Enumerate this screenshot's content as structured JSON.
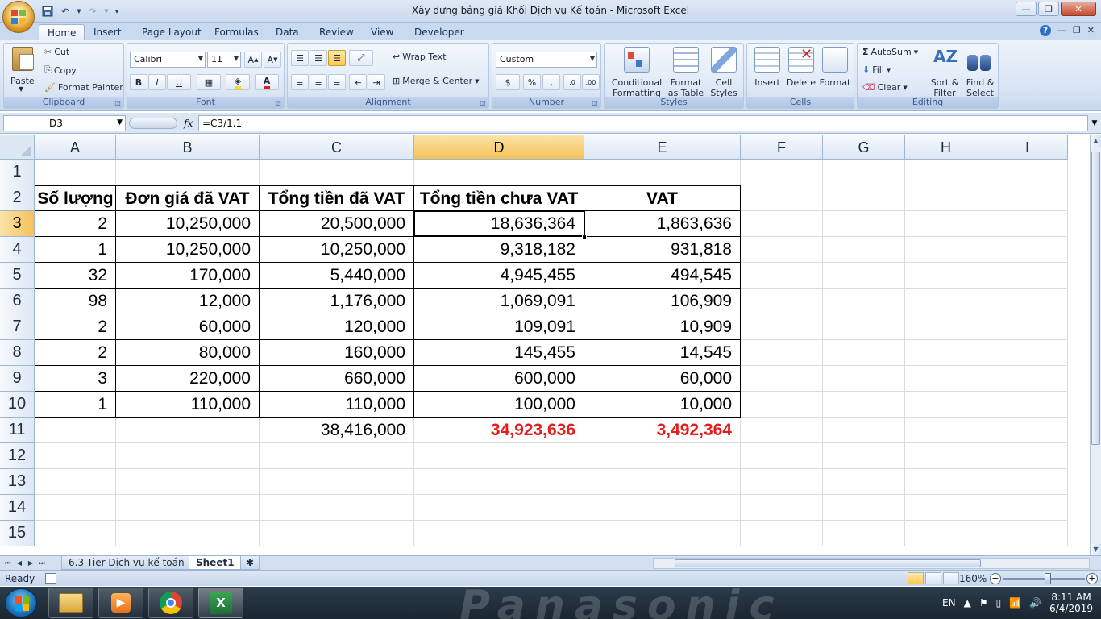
{
  "window": {
    "title": "Xây dựng bảng giá Khối Dịch vụ Kế toán - Microsoft Excel"
  },
  "ribbon_tabs": [
    "Home",
    "Insert",
    "Page Layout",
    "Formulas",
    "Data",
    "Review",
    "View",
    "Developer"
  ],
  "active_tab": "Home",
  "ribbon": {
    "clipboard": {
      "label": "Clipboard",
      "paste": "Paste",
      "cut": "Cut",
      "copy": "Copy",
      "format_painter": "Format Painter"
    },
    "font": {
      "label": "Font",
      "font_name": "Calibri",
      "font_size": "11",
      "bold": "B",
      "italic": "I",
      "underline": "U"
    },
    "alignment": {
      "label": "Alignment",
      "wrap_text": "Wrap Text",
      "merge_center": "Merge & Center"
    },
    "number": {
      "label": "Number",
      "format": "Custom",
      "currency": "$",
      "percent": "%",
      "comma": ","
    },
    "styles": {
      "label": "Styles",
      "conditional": "Conditional",
      "conditional2": "Formatting",
      "format_as": "Format",
      "format_as2": "as Table",
      "cell": "Cell",
      "cell2": "Styles"
    },
    "cells": {
      "label": "Cells",
      "insert": "Insert",
      "delete": "Delete",
      "format": "Format"
    },
    "editing": {
      "label": "Editing",
      "autosum": "AutoSum",
      "fill": "Fill",
      "clear": "Clear",
      "sort": "Sort &",
      "sort2": "Filter",
      "find": "Find &",
      "find2": "Select"
    }
  },
  "formula_bar": {
    "name_box": "D3",
    "fx": "fx",
    "formula": "=C3/1.1"
  },
  "columns": [
    "A",
    "B",
    "C",
    "D",
    "E",
    "F",
    "G",
    "H",
    "I"
  ],
  "rows": [
    "1",
    "2",
    "3",
    "4",
    "5",
    "6",
    "7",
    "8",
    "9",
    "10",
    "11",
    "12",
    "13",
    "14",
    "15"
  ],
  "selected_cell": "D3",
  "table": {
    "headers": [
      "Số lượng",
      "Đơn giá đã VAT",
      "Tổng tiền đã VAT",
      "Tổng tiền chưa VAT",
      "VAT"
    ],
    "data": [
      [
        "2",
        "10,250,000",
        "20,500,000",
        "18,636,364",
        "1,863,636"
      ],
      [
        "1",
        "10,250,000",
        "10,250,000",
        "9,318,182",
        "931,818"
      ],
      [
        "32",
        "170,000",
        "5,440,000",
        "4,945,455",
        "494,545"
      ],
      [
        "98",
        "12,000",
        "1,176,000",
        "1,069,091",
        "106,909"
      ],
      [
        "2",
        "60,000",
        "120,000",
        "109,091",
        "10,909"
      ],
      [
        "2",
        "80,000",
        "160,000",
        "145,455",
        "14,545"
      ],
      [
        "3",
        "220,000",
        "660,000",
        "600,000",
        "60,000"
      ],
      [
        "1",
        "110,000",
        "110,000",
        "100,000",
        "10,000"
      ]
    ],
    "totals": [
      "",
      "",
      "38,416,000",
      "34,923,636",
      "3,492,364"
    ],
    "total_color": "#e41c1c"
  },
  "sheets": [
    "6.3 Tier Dịch vụ kế toán",
    "Sheet1"
  ],
  "active_sheet": "Sheet1",
  "status": {
    "text": "Ready",
    "zoom": "160%"
  },
  "taskbar": {
    "brand": "Panasonic",
    "language": "EN",
    "time": "8:11 AM",
    "date": "6/4/2019",
    "apps": [
      "file-explorer-icon",
      "media-player-icon",
      "chrome-icon",
      "excel-icon"
    ]
  }
}
